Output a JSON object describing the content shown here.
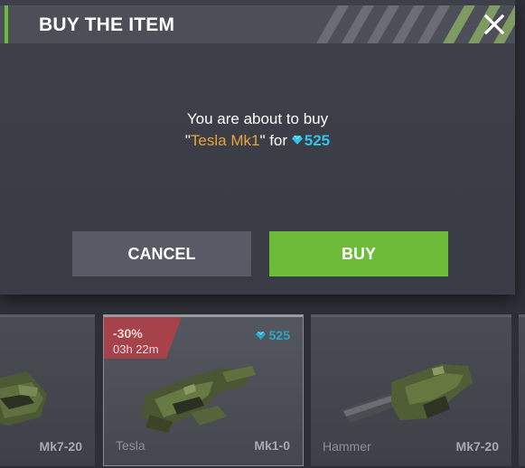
{
  "dialog": {
    "title": "BUY THE ITEM",
    "message_prefix": "You are about to buy",
    "quote_open": "\"",
    "item_name": "Tesla Mk1",
    "quote_close_for": "\" for ",
    "price": "525",
    "cancel_label": "CANCEL",
    "buy_label": "BUY",
    "close_icon": "close-icon",
    "currency_icon": "gem-icon"
  },
  "store_cards": [
    {
      "name": "",
      "level": "Mk7-20"
    },
    {
      "name": "Tesla",
      "level": "Mk1-0",
      "discount": "-30%",
      "timer": "03h 22m",
      "price": "525",
      "selected": true
    },
    {
      "name": "Hammer",
      "level": "Mk7-20"
    }
  ],
  "colors": {
    "accent_green": "#6cbc3a",
    "item_orange": "#e6a53a",
    "currency_cyan": "#33c2ea",
    "discount_red": "#a6434a"
  }
}
